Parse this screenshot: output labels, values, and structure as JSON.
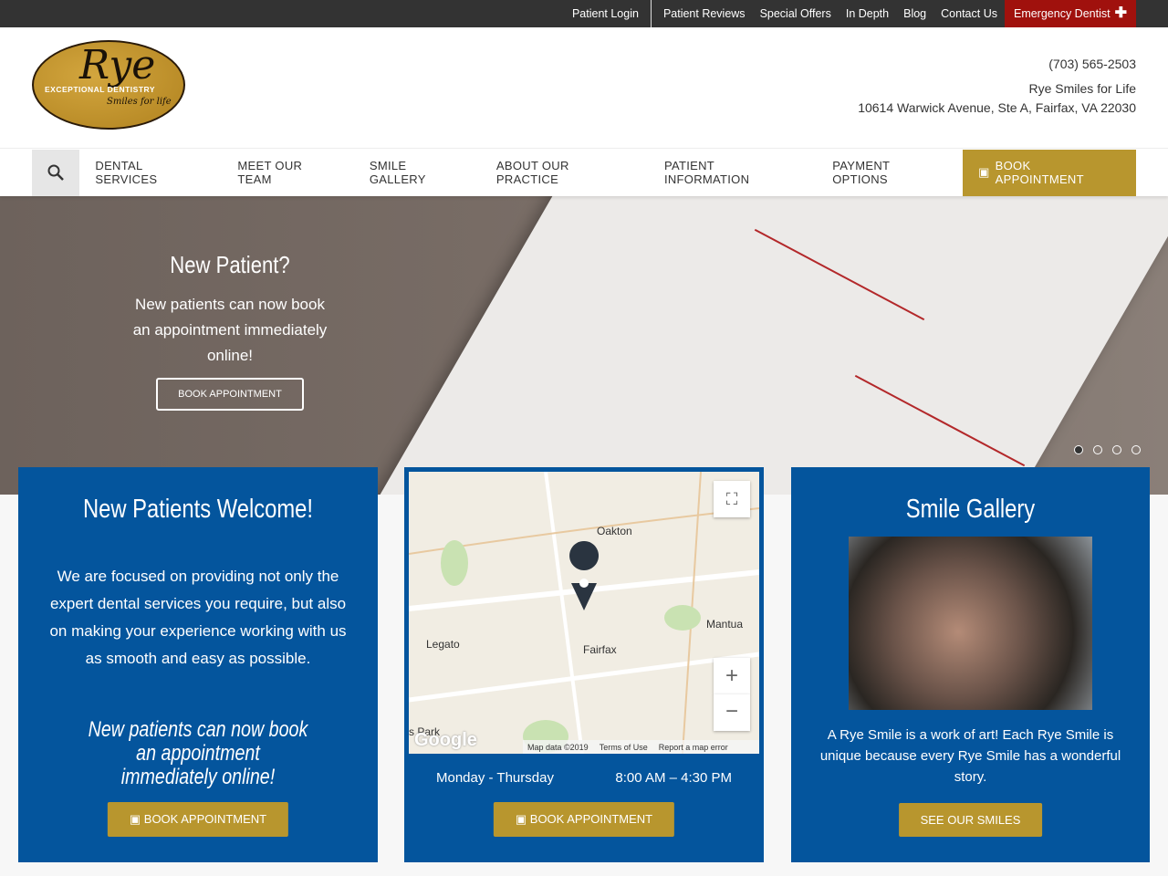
{
  "topbar": {
    "links": [
      "Patient Login",
      "Patient Reviews",
      "Special Offers",
      "In Depth",
      "Blog",
      "Contact Us"
    ],
    "emergency": "Emergency Dentist"
  },
  "logo": {
    "text": "Rye",
    "tagline": "EXCEPTIONAL DENTISTRY",
    "slogan": "Smiles for life"
  },
  "contact": {
    "phone": "(703) 565-2503",
    "name": "Rye Smiles for Life",
    "address": "10614 Warwick Avenue, Ste A, Fairfax, VA 22030"
  },
  "nav": {
    "items": [
      "DENTAL SERVICES",
      "MEET OUR TEAM",
      "SMILE GALLERY",
      "ABOUT OUR PRACTICE",
      "PATIENT INFORMATION",
      "PAYMENT OPTIONS"
    ],
    "book": "BOOK APPOINTMENT"
  },
  "hero": {
    "title": "New Patient?",
    "text": "New patients can now book an appointment immediately online!",
    "button": "BOOK APPOINTMENT",
    "slides": 4,
    "active_slide": 1
  },
  "card1": {
    "title": "New Patients Welcome!",
    "text": "We are focused on providing not only the expert dental services you require, but also on making your experience working with us as smooth and easy as possible.",
    "emphasis": "New patients can now book an appointment immediately online!",
    "button": "BOOK APPOINTMENT"
  },
  "card2": {
    "map": {
      "labels": [
        "Oakton",
        "Mantua",
        "Legato",
        "Fairfax",
        "s Park"
      ],
      "google": "Google",
      "data": "Map data ©2019",
      "terms": "Terms of Use",
      "report": "Report a map error"
    },
    "hours_days": "Monday - Thursday",
    "hours_time": "8:00 AM – 4:30 PM",
    "button": "BOOK APPOINTMENT"
  },
  "card3": {
    "title": "Smile Gallery",
    "text": "A Rye Smile is a work of art! Each Rye Smile is unique because every Rye Smile has a wonderful story.",
    "button": "SEE OUR SMILES"
  },
  "colors": {
    "blue": "#04559d",
    "gold": "#b8962e",
    "emergency": "#a0110d",
    "topbar": "#333333"
  }
}
